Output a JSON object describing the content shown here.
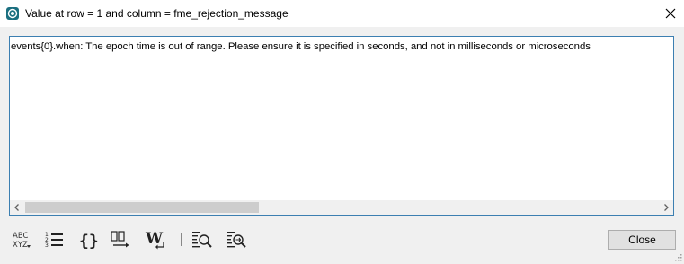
{
  "window": {
    "title": "Value at row = 1 and column = fme_rejection_message",
    "close_icon": "close-icon",
    "app_icon": "fme-app-icon"
  },
  "editor": {
    "text": "events{0}.when: The epoch time is out of range. Please ensure it is specified in seconds, and not in milliseconds or microseconds",
    "horizontal_scrollbar": true
  },
  "toolbar": {
    "items": [
      {
        "name": "spell-check-icon",
        "label": "ABC"
      },
      {
        "name": "line-numbers-icon"
      },
      {
        "name": "json-braces-icon",
        "label": "{}"
      },
      {
        "name": "column-view-icon"
      },
      {
        "name": "word-wrap-icon",
        "label": "W"
      },
      {
        "name": "find-icon"
      },
      {
        "name": "find-replace-icon"
      }
    ]
  },
  "buttons": {
    "close_label": "Close"
  },
  "colors": {
    "titlebar": "#ffffff",
    "window_bg": "#f0f0f0",
    "editor_border": "#3c7fb1",
    "app_icon": "#1b6f80"
  }
}
